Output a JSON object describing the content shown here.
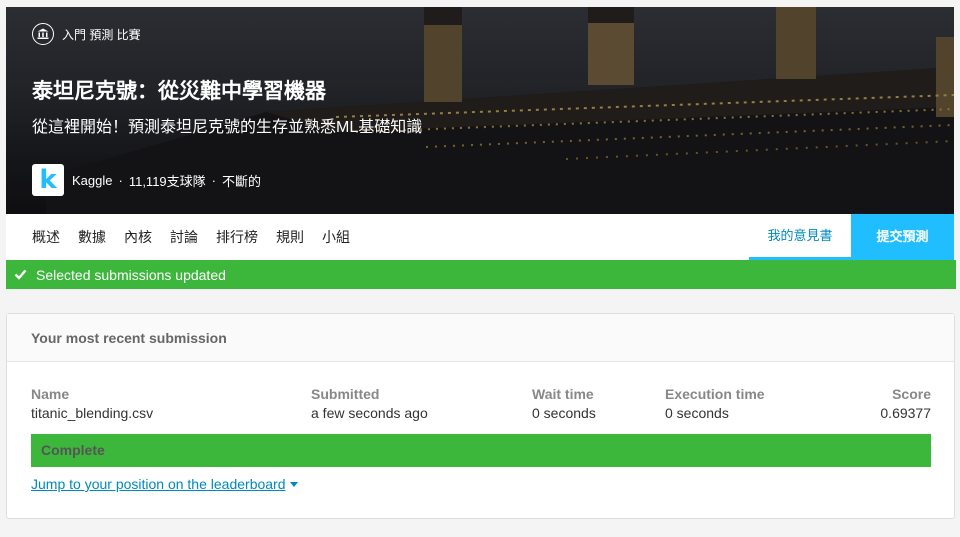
{
  "hero": {
    "badge_label": "入門 預測 比賽",
    "title": "泰坦尼克號：從災難中學習機器",
    "subtitle": "從這裡開始！預測泰坦尼克號的生存並熟悉ML基礎知識",
    "host": "Kaggle",
    "logo_letter": "k",
    "teams": "11,119支球隊",
    "duration": "不斷的",
    "separator": "·"
  },
  "tabs": {
    "items": [
      "概述",
      "數據",
      "內核",
      "討論",
      "排行榜",
      "規則",
      "小組"
    ],
    "discussion": "我的意見書",
    "submit": "提交預測"
  },
  "alert": {
    "message": "Selected submissions updated",
    "color": "#3cb73c"
  },
  "submission": {
    "header": "Your most recent submission",
    "name_label": "Name",
    "name_value": "titanic_blending.csv",
    "submitted_label": "Submitted",
    "submitted_value": "a few seconds ago",
    "wait_label": "Wait time",
    "wait_value": "0 seconds",
    "exec_label": "Execution time",
    "exec_value": "0 seconds",
    "score_label": "Score",
    "score_value": "0.69377",
    "status": "Complete",
    "jump_link": "Jump to your position on the leaderboard"
  }
}
